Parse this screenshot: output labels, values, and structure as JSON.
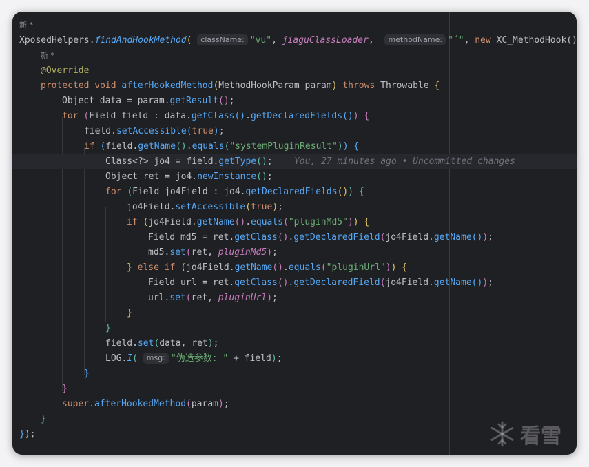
{
  "editor": {
    "authors": {
      "top": "新 *",
      "inner": "新 *"
    },
    "hints": {
      "className": "className:",
      "methodName": "methodName:",
      "msg": "msg:"
    },
    "tokens": {
      "xposedHelpers": "XposedHelpers.",
      "findAndHookMethod": "findAndHookMethod",
      "vu": "\"vu\"",
      "jiaguClassLoader": "jiaguClassLoader",
      "methodNameValue": "\"´\"",
      "newKw": "new",
      "xcMethodHook": " XC_MethodHook() ",
      "brace_tail": "{",
      "override": "@Override",
      "protectedVoid": "protected void",
      "afterHookedMethod": "afterHookedMethod",
      "methodHookParam": "MethodHookParam param",
      "throwsKw": "throws",
      "throwable": " Throwable ",
      "objectData": "Object data = param.",
      "getResult": "getResult",
      "forKw": "for",
      "fieldFieldData": "Field field : data.",
      "getClass": "getClass",
      "getDeclaredFields": "getDeclaredFields",
      "fieldDot": "field.",
      "setAccessible": "setAccessible",
      "trueKw": "true",
      "ifKw": "if",
      "getName": "getName",
      "equals": "equals",
      "systemPluginResult": "\"systemPluginResult\"",
      "classWild": "Class<?> jo4 = field.",
      "getType": "getType",
      "blame": "You, 27 minutes ago • Uncommitted changes",
      "objectRet": "Object ret = jo4.",
      "newInstance": "newInstance",
      "fieldJo4": "Field jo4Field : jo4.",
      "jo4FieldDot": "jo4Field.",
      "pluginMd5Str": "\"pluginMd5\"",
      "fieldMd5": "Field md5 = ret.",
      "getDeclaredField": "getDeclaredField",
      "md5Dot": "md5.",
      "set": "set",
      "retComma": "ret, ",
      "pluginMd5": "pluginMd5",
      "elseKw": "else",
      "pluginUrlStr": "\"pluginUrl\"",
      "fieldUrl": "Field url = ret.",
      "urlDot": "url.",
      "pluginUrl": "pluginUrl",
      "dataRet": "data, ret",
      "logDot": "LOG.",
      "logI": "I",
      "fakeParams": "\"伪造参数: \"",
      "plusField": " + field",
      "superDot": "super.",
      "param": "param"
    }
  },
  "watermark": {
    "text": "看雪"
  }
}
